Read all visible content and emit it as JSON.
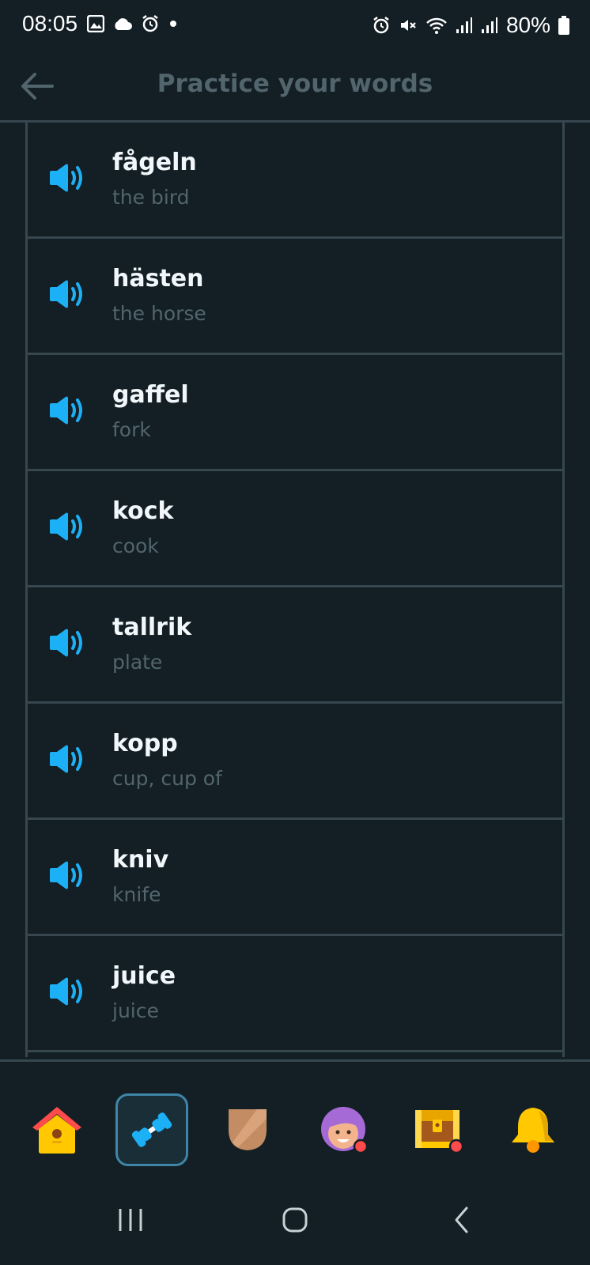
{
  "status_bar": {
    "time": "08:05",
    "battery": "80%",
    "left_icons": [
      "gallery-icon",
      "cloud-icon",
      "alarm-icon",
      "dot-icon"
    ],
    "right_icons": [
      "alarm-icon",
      "mute-icon",
      "wifi-icon",
      "signal-icon",
      "signal-icon",
      "battery-icon"
    ]
  },
  "header": {
    "title": "Practice your words",
    "back_icon": "arrow-left-icon"
  },
  "words": [
    {
      "term": "fågeln",
      "translation": "the bird"
    },
    {
      "term": "hästen",
      "translation": "the horse"
    },
    {
      "term": "gaffel",
      "translation": "fork"
    },
    {
      "term": "kock",
      "translation": "cook"
    },
    {
      "term": "tallrik",
      "translation": "plate"
    },
    {
      "term": "kopp",
      "translation": "cup, cup of"
    },
    {
      "term": "kniv",
      "translation": "knife"
    },
    {
      "term": "juice",
      "translation": "juice"
    }
  ],
  "bottom_nav": {
    "items": [
      "home-icon",
      "practice-dumbbell-icon",
      "league-shield-icon",
      "profile-avatar-icon",
      "chest-icon",
      "notifications-bell-icon"
    ],
    "active": "practice-dumbbell-icon"
  },
  "colors": {
    "background": "#131f24",
    "border": "#37464f",
    "accent_blue": "#1cb0f6",
    "muted_text": "#52656d"
  }
}
